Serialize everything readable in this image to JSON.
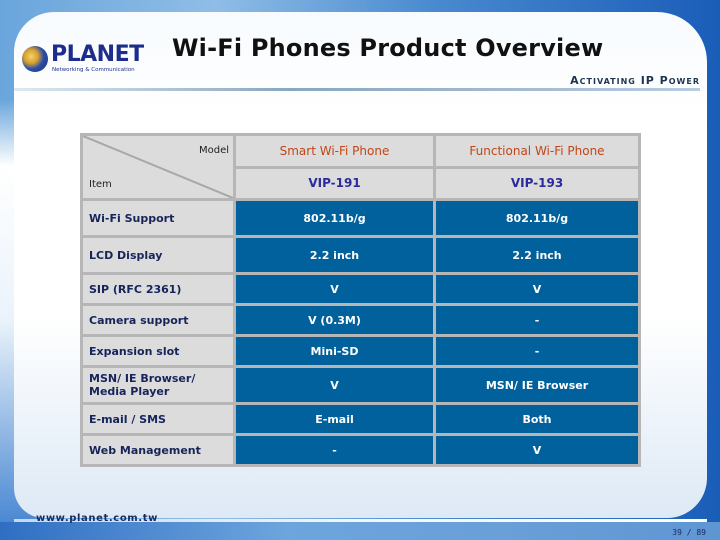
{
  "header": {
    "logo": {
      "name": "PLANET",
      "tagline": "Networking & Communication",
      "icon": "globe-icon"
    },
    "title": "Wi-Fi Phones Product Overview",
    "slogan": "Activating IP Power"
  },
  "table": {
    "corner": {
      "top_label": "Model",
      "bottom_label": "Item"
    },
    "models": [
      {
        "name": "Smart Wi-Fi Phone",
        "code": "VIP-191"
      },
      {
        "name": "Functional Wi-Fi Phone",
        "code": "VIP-193"
      }
    ],
    "rows": [
      {
        "feature": "Wi-Fi Support",
        "values": [
          "802.11b/g",
          "802.11b/g"
        ]
      },
      {
        "feature": "LCD Display",
        "values": [
          "2.2 inch",
          "2.2 inch"
        ]
      },
      {
        "feature": "SIP (RFC 2361)",
        "values": [
          "V",
          "V"
        ]
      },
      {
        "feature": "Camera support",
        "values": [
          "V (0.3M)",
          "-"
        ]
      },
      {
        "feature": "Expansion slot",
        "values": [
          "Mini-SD",
          "-"
        ]
      },
      {
        "feature_line1": "MSN/ IE Browser/",
        "feature_line2": "Media Player",
        "values": [
          "V",
          "MSN/ IE Browser"
        ]
      },
      {
        "feature": "E-mail / SMS",
        "values": [
          "E-mail",
          "Both"
        ]
      },
      {
        "feature": "Web Management",
        "values": [
          "-",
          "V"
        ]
      }
    ]
  },
  "footer": {
    "url": "www.planet.com.tw",
    "page": "39 / 89"
  },
  "colors": {
    "value_cell": "#00619c",
    "label_cell": "#dcdcdc",
    "model_name": "#c0461a",
    "model_code": "#2b2b9c",
    "brand": "#1c2d8c"
  }
}
